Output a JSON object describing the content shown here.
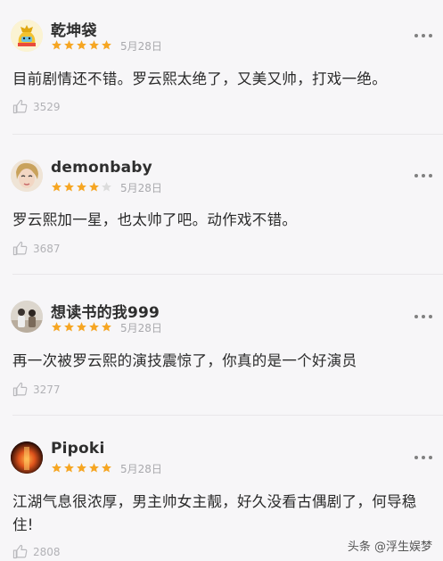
{
  "reviews": [
    {
      "username": "乾坤袋",
      "rating": 5,
      "date": "5月28日",
      "text": "目前剧情还不错。罗云熙太绝了，又美又帅，打戏一绝。",
      "likes": "3529",
      "avatar": "cartoon-moneybag-avatar"
    },
    {
      "username": "demonbaby",
      "rating": 4,
      "date": "5月28日",
      "text": "罗云熙加一星，也太帅了吧。动作戏不错。",
      "likes": "3687",
      "avatar": "portrait-avatar"
    },
    {
      "username": "想读书的我999",
      "rating": 5,
      "date": "5月28日",
      "text": "再一次被罗云熙的演技震惊了，你真的是一个好演员",
      "likes": "3277",
      "avatar": "photo-avatar"
    },
    {
      "username": "Pipoki",
      "rating": 5,
      "date": "5月28日",
      "text": "江湖气息很浓厚，男主帅女主靓，好久没看古偶剧了，何导稳住!",
      "likes": "2808",
      "avatar": "orange-glow-avatar"
    }
  ],
  "watermark": "头条 @浮生娱梦",
  "colors": {
    "star_filled": "#f6a623",
    "star_empty": "#dcdcdc",
    "background": "#f7f6f8"
  },
  "icons": {
    "more": "more-dots-icon",
    "like": "thumbs-up-icon",
    "star": "star-icon"
  }
}
